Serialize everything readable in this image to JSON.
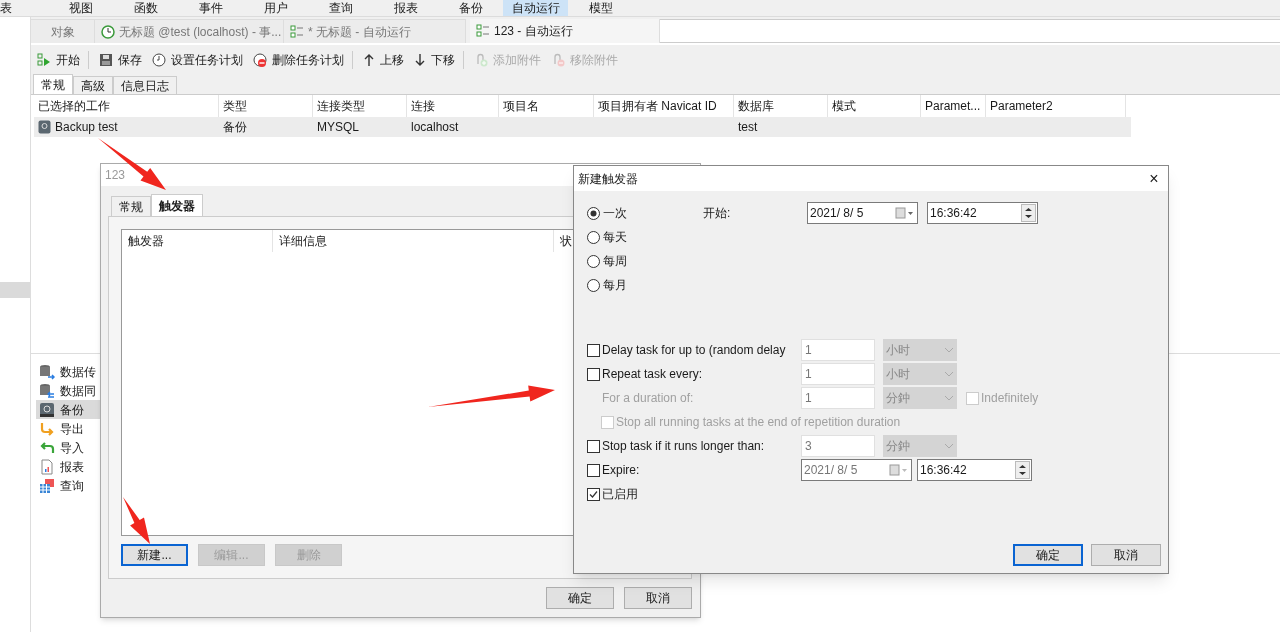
{
  "menu": [
    {
      "label": "表",
      "selected": false
    },
    {
      "label": "视图",
      "selected": false
    },
    {
      "label": "函数",
      "selected": false
    },
    {
      "label": "事件",
      "selected": false
    },
    {
      "label": "用户",
      "selected": false
    },
    {
      "label": "查询",
      "selected": false
    },
    {
      "label": "报表",
      "selected": false
    },
    {
      "label": "备份",
      "selected": false
    },
    {
      "label": "自动运行",
      "selected": true
    },
    {
      "label": "模型",
      "selected": false
    }
  ],
  "doc_tabs": [
    {
      "label": "对象",
      "kind": "plain",
      "selected": false
    },
    {
      "label": "无标题 @test (localhost) - 事...",
      "kind": "event",
      "selected": false
    },
    {
      "label": "* 无标题 - 自动运行",
      "kind": "automation",
      "selected": false
    },
    {
      "label": "123 - 自动运行",
      "kind": "automation",
      "selected": true
    }
  ],
  "toolbar": [
    {
      "label": "开始",
      "kind": "start",
      "disabled": false,
      "separator_after": true
    },
    {
      "label": "保存",
      "kind": "save",
      "disabled": false,
      "separator_after": false
    },
    {
      "label": "设置任务计划",
      "kind": "clock",
      "disabled": false,
      "separator_after": false
    },
    {
      "label": "删除任务计划",
      "kind": "remove-schedule",
      "disabled": false,
      "separator_after": true
    },
    {
      "label": "上移",
      "kind": "up",
      "disabled": false,
      "separator_after": false
    },
    {
      "label": "下移",
      "kind": "down",
      "disabled": false,
      "separator_after": true
    },
    {
      "label": "添加附件",
      "kind": "attach",
      "disabled": true,
      "separator_after": false
    },
    {
      "label": "移除附件",
      "kind": "detach",
      "disabled": true,
      "separator_after": false
    }
  ],
  "sub_tabs": [
    {
      "label": "常规",
      "selected": true
    },
    {
      "label": "高级",
      "selected": false
    },
    {
      "label": "信息日志",
      "selected": false
    }
  ],
  "jobs_table": {
    "columns": [
      "已选择的工作",
      "类型",
      "连接类型",
      "连接",
      "项目名",
      "项目拥有者 Navicat ID",
      "数据库",
      "模式",
      "Paramet...",
      "Parameter2"
    ],
    "rows": [
      {
        "cells": [
          "Backup test",
          "备份",
          "MYSQL",
          "localhost",
          "",
          "",
          "test",
          "",
          "",
          ""
        ]
      }
    ]
  },
  "tools": [
    {
      "label": "数据传",
      "kind": "transfer",
      "selected": false
    },
    {
      "label": "数据同",
      "kind": "sync",
      "selected": false
    },
    {
      "label": "备份",
      "kind": "backup",
      "selected": true
    },
    {
      "label": "导出",
      "kind": "export",
      "selected": false
    },
    {
      "label": "导入",
      "kind": "import",
      "selected": false
    },
    {
      "label": "报表",
      "kind": "report",
      "selected": false
    },
    {
      "label": "查询",
      "kind": "query",
      "selected": false
    }
  ],
  "task_dialog": {
    "title": "123",
    "tabs": [
      {
        "label": "常规",
        "selected": false
      },
      {
        "label": "触发器",
        "selected": true
      }
    ],
    "trigger_columns": [
      "触发器",
      "详细信息",
      "状"
    ],
    "buttons": [
      {
        "label": "新建...",
        "disabled": false,
        "focused": true
      },
      {
        "label": "编辑...",
        "disabled": true,
        "focused": false
      },
      {
        "label": "删除",
        "disabled": true,
        "focused": false
      }
    ],
    "footer_buttons": [
      {
        "label": "确定"
      },
      {
        "label": "取消"
      }
    ]
  },
  "trigger_dialog": {
    "title": "新建触发器",
    "close": "×",
    "schedules": [
      {
        "label": "一次",
        "selected": true
      },
      {
        "label": "每天",
        "selected": false
      },
      {
        "label": "每周",
        "selected": false
      },
      {
        "label": "每月",
        "selected": false
      }
    ],
    "start_label": "开始:",
    "start_date": "2021/ 8/ 5",
    "start_time": "16:36:42",
    "options": [
      {
        "kind": "check",
        "label": "Delay task for up to (random delay",
        "checked": false,
        "disabled": false,
        "value": "1",
        "unit": "小时"
      },
      {
        "kind": "check",
        "label": "Repeat task every:",
        "checked": false,
        "disabled": false,
        "value": "1",
        "unit": "小时"
      },
      {
        "kind": "sub",
        "label": "For a duration of:",
        "disabled": true,
        "value": "1",
        "unit": "分鈡",
        "extra": {
          "label": "Indefinitely",
          "checked": false
        }
      },
      {
        "kind": "subcheck",
        "label": "Stop all running tasks at the end of repetition duration",
        "checked": false,
        "disabled": true
      },
      {
        "kind": "check",
        "label": "Stop task if it runs longer than:",
        "checked": false,
        "disabled": false,
        "value": "3",
        "unit": "分鈡"
      },
      {
        "kind": "datetime",
        "label": "Expire:",
        "checked": false,
        "disabled": false,
        "date": "2021/ 8/ 5",
        "time": "16:36:42"
      },
      {
        "kind": "check",
        "label": "已启用",
        "checked": true,
        "disabled": false
      }
    ],
    "buttons": [
      {
        "label": "确定",
        "focused": true
      },
      {
        "label": "取消",
        "focused": false
      }
    ]
  }
}
